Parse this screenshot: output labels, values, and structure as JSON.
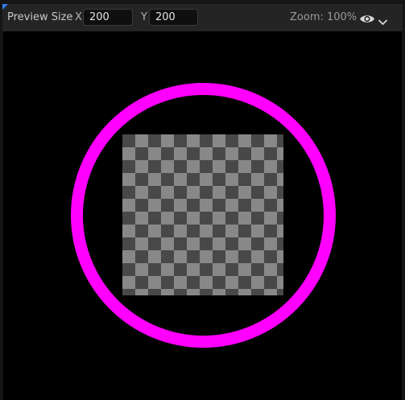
{
  "toolbar": {
    "preview_size_label": "Preview Size",
    "x_label": "X",
    "x_value": "200",
    "y_label": "Y",
    "y_value": "200",
    "zoom_text": "Zoom: 100%",
    "view_options_icon": "eye-icon",
    "view_options_dropdown_icon": "chevron-down-icon"
  },
  "viewport": {
    "background_color": "#000000",
    "ring_color": "#ff00ff",
    "checker_colors": [
      "#888888",
      "#484848"
    ]
  },
  "colors": {
    "toolbar_background": "#242424",
    "accent_marker": "#2f7fe8"
  }
}
